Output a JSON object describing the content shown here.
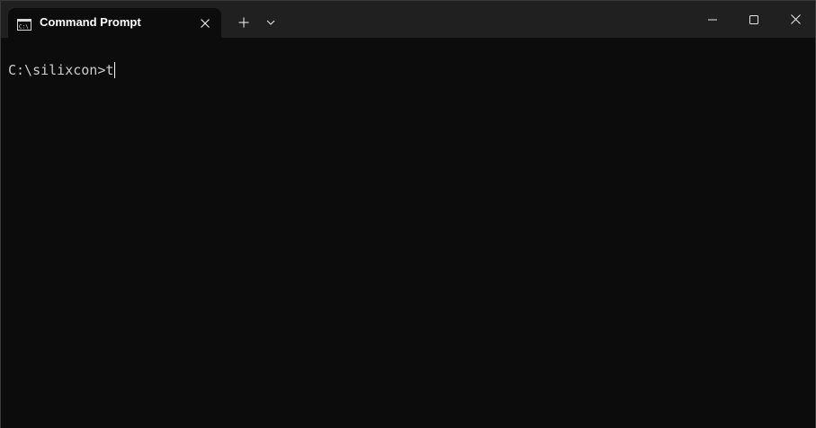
{
  "window": {
    "tab_title": "Command Prompt"
  },
  "terminal": {
    "prompt": "C:\\silixcon>",
    "input": "t"
  },
  "icons": {
    "tab": "cmd-app-icon",
    "tab_close": "close-icon",
    "new_tab": "plus-icon",
    "dropdown": "chevron-down-icon",
    "minimize": "minimize-icon",
    "maximize": "maximize-icon",
    "close": "close-icon"
  },
  "colors": {
    "background": "#0c0c0c",
    "titlebar": "#202020",
    "text": "#cccccc"
  }
}
